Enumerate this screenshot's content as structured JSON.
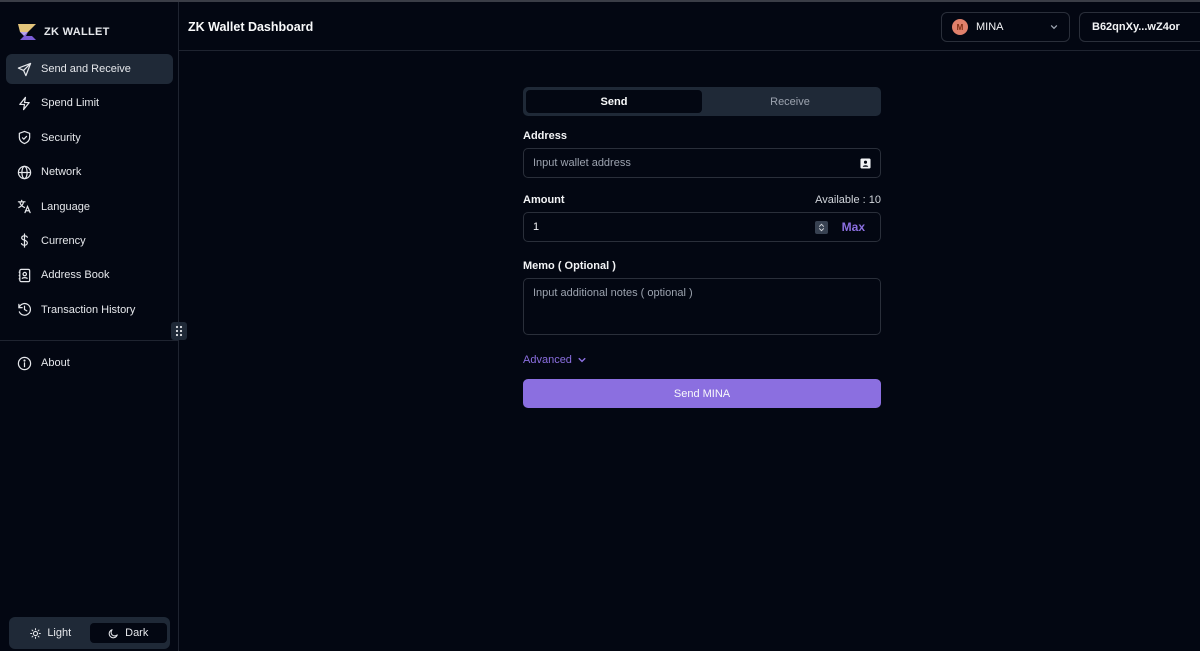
{
  "app": {
    "logo_text": "ZK WALLET",
    "page_title": "ZK Wallet Dashboard"
  },
  "sidebar": {
    "items": [
      {
        "label": "Send and Receive",
        "icon": "send-icon",
        "active": true
      },
      {
        "label": "Spend Limit",
        "icon": "bolt-icon"
      },
      {
        "label": "Security",
        "icon": "shield-icon"
      },
      {
        "label": "Network",
        "icon": "globe-icon"
      },
      {
        "label": "Language",
        "icon": "translate-icon"
      },
      {
        "label": "Currency",
        "icon": "dollar-icon"
      },
      {
        "label": "Address Book",
        "icon": "contact-icon"
      },
      {
        "label": "Transaction History",
        "icon": "history-icon"
      }
    ],
    "about": {
      "label": "About",
      "icon": "info-icon"
    },
    "theme": {
      "light": "Light",
      "dark": "Dark",
      "selected": "Dark"
    }
  },
  "header": {
    "token": {
      "label": "MINA",
      "logo_letter": "M"
    },
    "account": "B62qnXy...wZ4or"
  },
  "form": {
    "tabs": {
      "send": "Send",
      "receive": "Receive",
      "active": "Send"
    },
    "address": {
      "label": "Address",
      "placeholder": "Input wallet address",
      "value": ""
    },
    "amount": {
      "label": "Amount",
      "available": "Available : 10",
      "value": "1",
      "max_label": "Max"
    },
    "memo": {
      "label": "Memo ( Optional )",
      "placeholder": "Input additional notes ( optional )"
    },
    "advanced_label": "Advanced",
    "submit_label": "Send MINA"
  },
  "colors": {
    "accent": "#8b6fe0",
    "background": "#030712",
    "surface": "#1f2937"
  }
}
